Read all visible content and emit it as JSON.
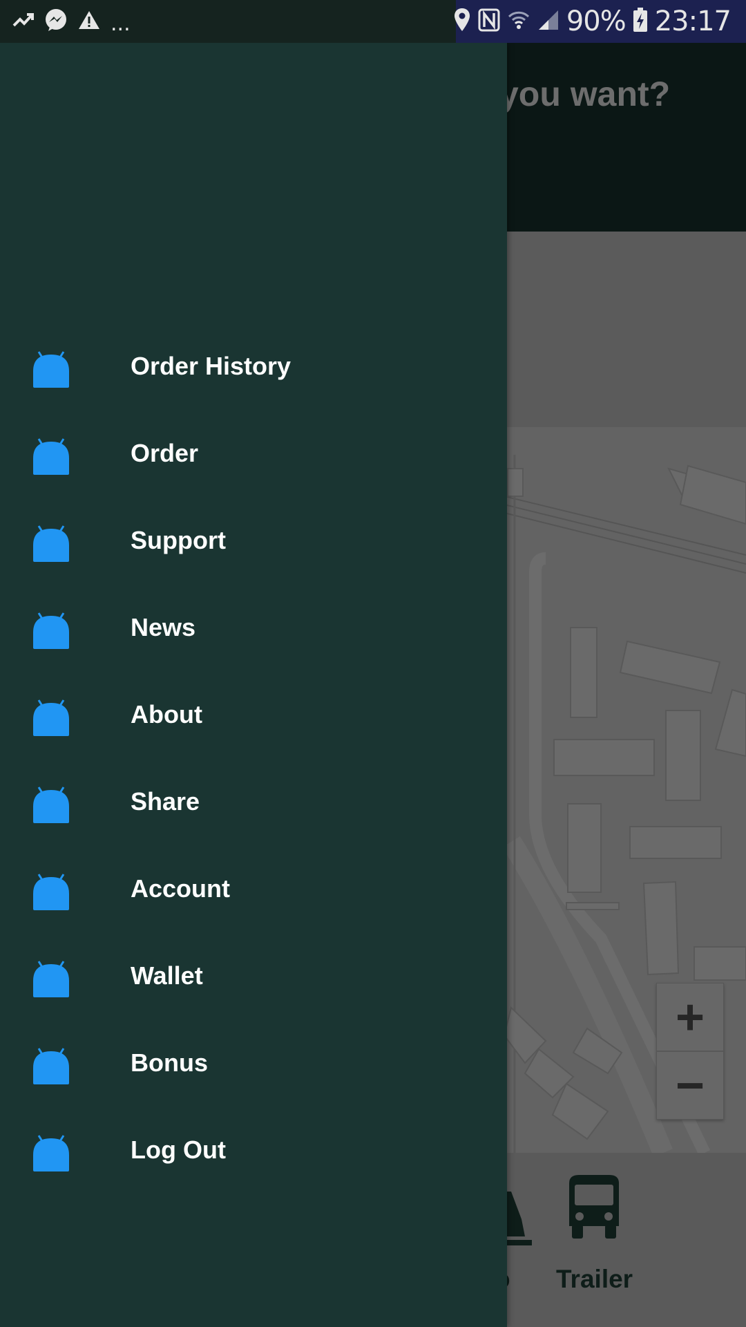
{
  "status_bar": {
    "battery_percent": "90%",
    "time": "23:17",
    "more_indicator": "...",
    "left_icons": [
      "trending-up-icon",
      "messenger-icon",
      "warning-icon"
    ],
    "right_icons": [
      "location-pin-icon",
      "nfc-icon",
      "wifi-icon",
      "signal-icon",
      "battery-charging-icon"
    ]
  },
  "background_app": {
    "toolbar_title_visible": "do you want?",
    "zoom_in_label": "+",
    "zoom_out_label": "−",
    "vehicle_tabs": [
      {
        "label": "o",
        "icon": "truck-icon"
      },
      {
        "label": "Trailer",
        "icon": "bus-icon"
      }
    ]
  },
  "drawer": {
    "items": [
      {
        "label": "Order History",
        "icon": "android-icon"
      },
      {
        "label": "Order",
        "icon": "android-icon"
      },
      {
        "label": "Support",
        "icon": "android-icon"
      },
      {
        "label": "News",
        "icon": "android-icon"
      },
      {
        "label": "About",
        "icon": "android-icon"
      },
      {
        "label": "Share",
        "icon": "android-icon"
      },
      {
        "label": "Account",
        "icon": "android-icon"
      },
      {
        "label": "Wallet",
        "icon": "android-icon"
      },
      {
        "label": "Bonus",
        "icon": "android-icon"
      },
      {
        "label": "Log Out",
        "icon": "android-icon"
      }
    ]
  },
  "colors": {
    "drawer_background": "#1a3532",
    "icon_accent": "#2196f3",
    "status_bar": "#15231f",
    "status_bar_right": "#1c2150",
    "scrim_toolbar": "#0b1715",
    "map_dimmed": "#636363"
  }
}
